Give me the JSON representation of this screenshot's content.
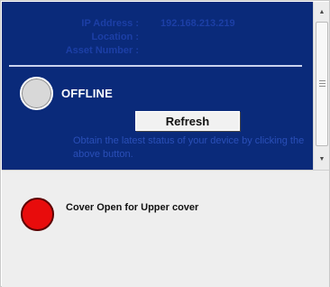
{
  "device_info": {
    "ip_address_label": "IP Address :",
    "ip_address_value": "192.168.213.219",
    "location_label": "Location :",
    "location_value": "",
    "asset_number_label": "Asset Number :",
    "asset_number_value": ""
  },
  "status": {
    "icon": "status-circle-icon",
    "indicator_color": "#d8d8d8",
    "text": "OFFLINE"
  },
  "refresh": {
    "label": "Refresh",
    "hint": "Obtain the latest status of your device by clicking the above button."
  },
  "alert": {
    "icon": "alert-circle-icon",
    "indicator_color": "#e80c0c",
    "message": "Cover Open for Upper cover"
  },
  "colors": {
    "panel_background": "#0a2a7a",
    "accent_text": "#1c3fa6"
  }
}
